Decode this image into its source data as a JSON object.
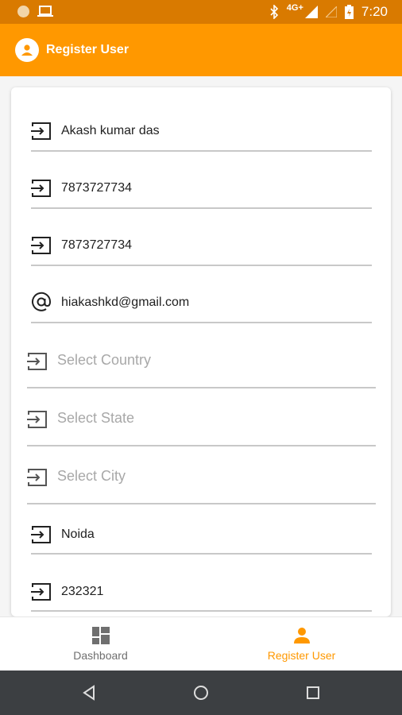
{
  "status_bar": {
    "time": "7:20",
    "network": "4G+",
    "icons": [
      "notification-dot-icon",
      "laptop-icon",
      "bluetooth-icon",
      "signal-icon",
      "battery-icon"
    ]
  },
  "app_bar": {
    "title": "Register User",
    "icon": "account-circle-icon"
  },
  "form": {
    "fields": [
      {
        "icon": "input-icon",
        "value": "Akash kumar das",
        "placeholder": ""
      },
      {
        "icon": "input-icon",
        "value": "7873727734",
        "placeholder": ""
      },
      {
        "icon": "input-icon",
        "value": "7873727734",
        "placeholder": ""
      },
      {
        "icon": "at-sign-icon",
        "value": "hiakashkd@gmail.com",
        "placeholder": ""
      },
      {
        "icon": "input-icon",
        "value": "",
        "placeholder": "Select Country"
      },
      {
        "icon": "input-icon",
        "value": "",
        "placeholder": "Select State"
      },
      {
        "icon": "input-icon",
        "value": "",
        "placeholder": "Select City"
      },
      {
        "icon": "input-icon",
        "value": "Noida",
        "placeholder": ""
      },
      {
        "icon": "input-icon",
        "value": "232321",
        "placeholder": ""
      }
    ]
  },
  "bottom_nav": {
    "items": [
      {
        "label": "Dashboard",
        "icon": "dashboard-icon",
        "active": false
      },
      {
        "label": "Register User",
        "icon": "person-icon",
        "active": true
      }
    ]
  },
  "colors": {
    "status_bar": "#d97a00",
    "primary": "#ff9800",
    "placeholder": "#a8a8a8",
    "divider": "#c8c8c8",
    "system_nav": "#3c3f42"
  }
}
